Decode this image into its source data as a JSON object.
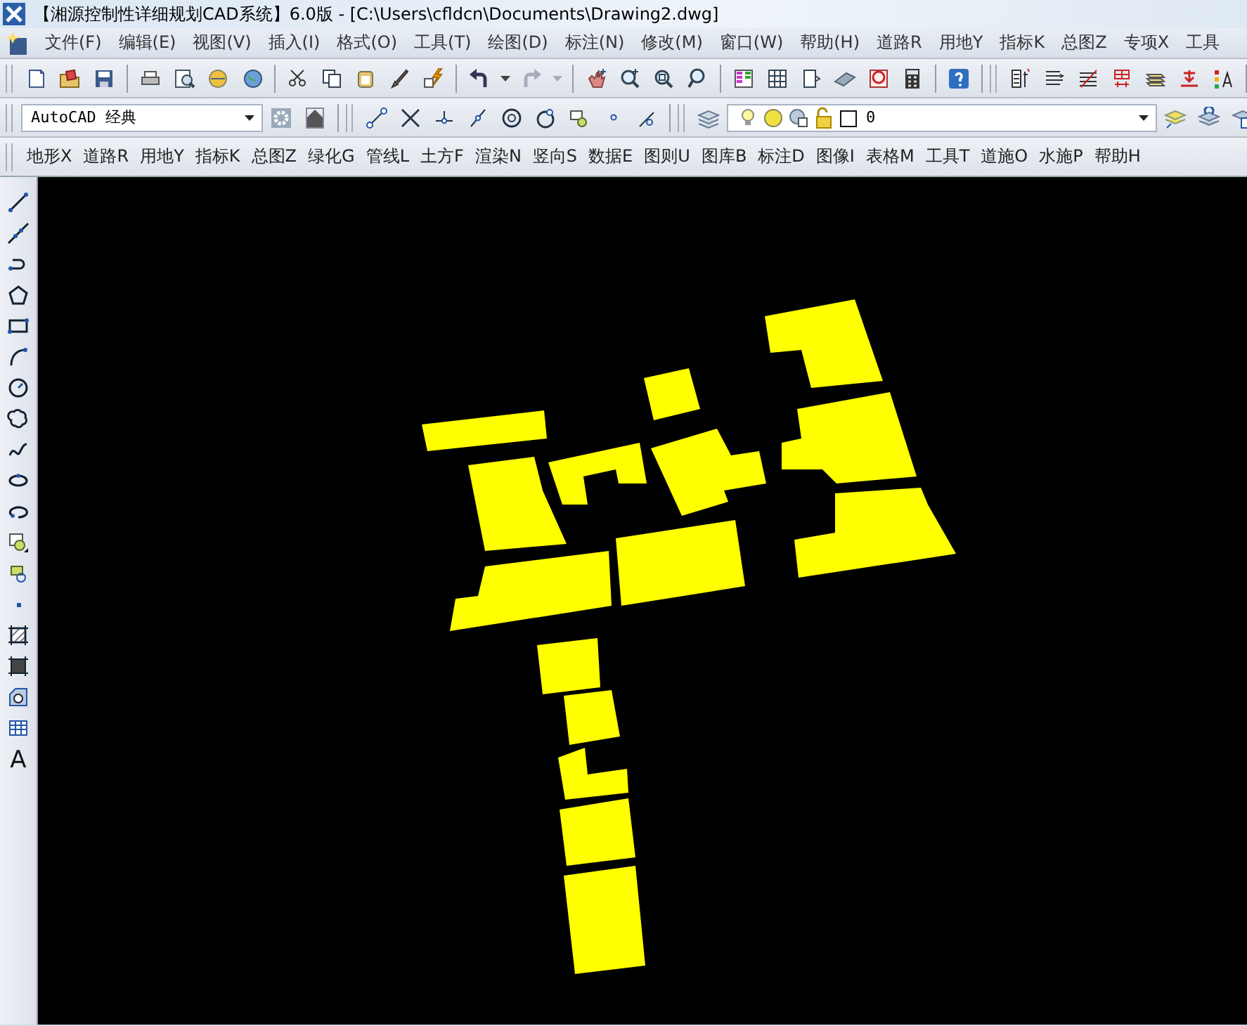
{
  "window": {
    "title": "【湘源控制性详细规划CAD系统】6.0版 - [C:\\Users\\cfldcn\\Documents\\Drawing2.dwg]"
  },
  "menu_bar": [
    "文件(F)",
    "编辑(E)",
    "视图(V)",
    "插入(I)",
    "格式(O)",
    "工具(T)",
    "绘图(D)",
    "标注(N)",
    "修改(M)",
    "窗口(W)",
    "帮助(H)",
    "道路R",
    "用地Y",
    "指标K",
    "总图Z",
    "专项X",
    "工具"
  ],
  "workspace_combo": {
    "value": "AutoCAD 经典"
  },
  "layer_combo": {
    "value": "0"
  },
  "command_menu": [
    "地形X",
    "道路R",
    "用地Y",
    "指标K",
    "总图Z",
    "绿化G",
    "管线L",
    "土方F",
    "渲染N",
    "竖向S",
    "数据E",
    "图则U",
    "图库B",
    "标注D",
    "图像I",
    "表格M",
    "工具T",
    "道施O",
    "水施P",
    "帮助H"
  ],
  "draw_toolbar": {
    "text_tool": "A"
  }
}
